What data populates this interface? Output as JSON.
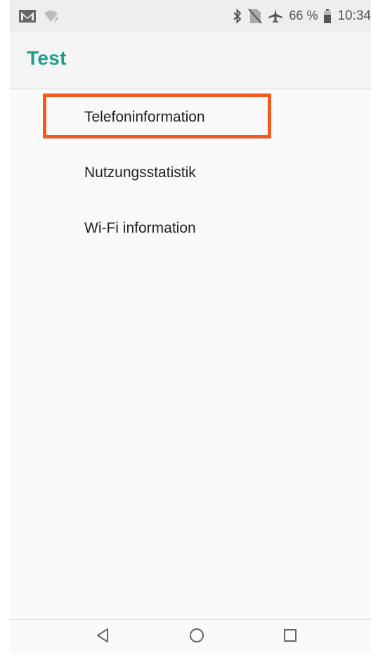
{
  "status_bar": {
    "left_icons": [
      "gmail-icon",
      "wifi-question-icon"
    ],
    "right_icons": [
      "bluetooth-icon",
      "no-sim-icon",
      "airplane-icon",
      "battery-icon"
    ],
    "battery": "66 %",
    "time": "10:34"
  },
  "app_bar": {
    "title": "Test"
  },
  "menu": {
    "items": [
      {
        "label": "Telefoninformation",
        "highlighted": true
      },
      {
        "label": "Nutzungsstatistik"
      },
      {
        "label": "Wi-Fi information"
      }
    ]
  },
  "nav_bar": {
    "buttons": [
      "back-icon",
      "home-icon",
      "recents-icon"
    ]
  },
  "colors": {
    "accent": "#1e9e8b",
    "highlight_box": "#f25a1f",
    "status_bar_bg": "#eeeeee",
    "background": "#fafafa"
  }
}
